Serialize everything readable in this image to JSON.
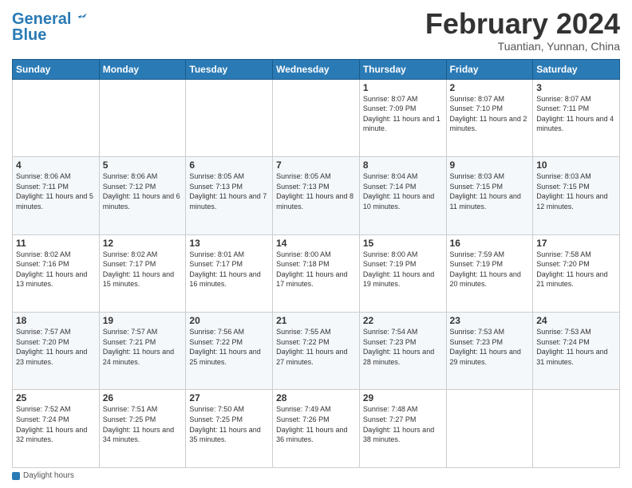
{
  "header": {
    "logo_line1": "General",
    "logo_line2": "Blue",
    "month_title": "February 2024",
    "location": "Tuantian, Yunnan, China"
  },
  "weekdays": [
    "Sunday",
    "Monday",
    "Tuesday",
    "Wednesday",
    "Thursday",
    "Friday",
    "Saturday"
  ],
  "weeks": [
    [
      {
        "day": "",
        "sunrise": "",
        "sunset": "",
        "daylight": ""
      },
      {
        "day": "",
        "sunrise": "",
        "sunset": "",
        "daylight": ""
      },
      {
        "day": "",
        "sunrise": "",
        "sunset": "",
        "daylight": ""
      },
      {
        "day": "",
        "sunrise": "",
        "sunset": "",
        "daylight": ""
      },
      {
        "day": "1",
        "sunrise": "Sunrise: 8:07 AM",
        "sunset": "Sunset: 7:09 PM",
        "daylight": "Daylight: 11 hours and 1 minute."
      },
      {
        "day": "2",
        "sunrise": "Sunrise: 8:07 AM",
        "sunset": "Sunset: 7:10 PM",
        "daylight": "Daylight: 11 hours and 2 minutes."
      },
      {
        "day": "3",
        "sunrise": "Sunrise: 8:07 AM",
        "sunset": "Sunset: 7:11 PM",
        "daylight": "Daylight: 11 hours and 4 minutes."
      }
    ],
    [
      {
        "day": "4",
        "sunrise": "Sunrise: 8:06 AM",
        "sunset": "Sunset: 7:11 PM",
        "daylight": "Daylight: 11 hours and 5 minutes."
      },
      {
        "day": "5",
        "sunrise": "Sunrise: 8:06 AM",
        "sunset": "Sunset: 7:12 PM",
        "daylight": "Daylight: 11 hours and 6 minutes."
      },
      {
        "day": "6",
        "sunrise": "Sunrise: 8:05 AM",
        "sunset": "Sunset: 7:13 PM",
        "daylight": "Daylight: 11 hours and 7 minutes."
      },
      {
        "day": "7",
        "sunrise": "Sunrise: 8:05 AM",
        "sunset": "Sunset: 7:13 PM",
        "daylight": "Daylight: 11 hours and 8 minutes."
      },
      {
        "day": "8",
        "sunrise": "Sunrise: 8:04 AM",
        "sunset": "Sunset: 7:14 PM",
        "daylight": "Daylight: 11 hours and 10 minutes."
      },
      {
        "day": "9",
        "sunrise": "Sunrise: 8:03 AM",
        "sunset": "Sunset: 7:15 PM",
        "daylight": "Daylight: 11 hours and 11 minutes."
      },
      {
        "day": "10",
        "sunrise": "Sunrise: 8:03 AM",
        "sunset": "Sunset: 7:15 PM",
        "daylight": "Daylight: 11 hours and 12 minutes."
      }
    ],
    [
      {
        "day": "11",
        "sunrise": "Sunrise: 8:02 AM",
        "sunset": "Sunset: 7:16 PM",
        "daylight": "Daylight: 11 hours and 13 minutes."
      },
      {
        "day": "12",
        "sunrise": "Sunrise: 8:02 AM",
        "sunset": "Sunset: 7:17 PM",
        "daylight": "Daylight: 11 hours and 15 minutes."
      },
      {
        "day": "13",
        "sunrise": "Sunrise: 8:01 AM",
        "sunset": "Sunset: 7:17 PM",
        "daylight": "Daylight: 11 hours and 16 minutes."
      },
      {
        "day": "14",
        "sunrise": "Sunrise: 8:00 AM",
        "sunset": "Sunset: 7:18 PM",
        "daylight": "Daylight: 11 hours and 17 minutes."
      },
      {
        "day": "15",
        "sunrise": "Sunrise: 8:00 AM",
        "sunset": "Sunset: 7:19 PM",
        "daylight": "Daylight: 11 hours and 19 minutes."
      },
      {
        "day": "16",
        "sunrise": "Sunrise: 7:59 AM",
        "sunset": "Sunset: 7:19 PM",
        "daylight": "Daylight: 11 hours and 20 minutes."
      },
      {
        "day": "17",
        "sunrise": "Sunrise: 7:58 AM",
        "sunset": "Sunset: 7:20 PM",
        "daylight": "Daylight: 11 hours and 21 minutes."
      }
    ],
    [
      {
        "day": "18",
        "sunrise": "Sunrise: 7:57 AM",
        "sunset": "Sunset: 7:20 PM",
        "daylight": "Daylight: 11 hours and 23 minutes."
      },
      {
        "day": "19",
        "sunrise": "Sunrise: 7:57 AM",
        "sunset": "Sunset: 7:21 PM",
        "daylight": "Daylight: 11 hours and 24 minutes."
      },
      {
        "day": "20",
        "sunrise": "Sunrise: 7:56 AM",
        "sunset": "Sunset: 7:22 PM",
        "daylight": "Daylight: 11 hours and 25 minutes."
      },
      {
        "day": "21",
        "sunrise": "Sunrise: 7:55 AM",
        "sunset": "Sunset: 7:22 PM",
        "daylight": "Daylight: 11 hours and 27 minutes."
      },
      {
        "day": "22",
        "sunrise": "Sunrise: 7:54 AM",
        "sunset": "Sunset: 7:23 PM",
        "daylight": "Daylight: 11 hours and 28 minutes."
      },
      {
        "day": "23",
        "sunrise": "Sunrise: 7:53 AM",
        "sunset": "Sunset: 7:23 PM",
        "daylight": "Daylight: 11 hours and 29 minutes."
      },
      {
        "day": "24",
        "sunrise": "Sunrise: 7:53 AM",
        "sunset": "Sunset: 7:24 PM",
        "daylight": "Daylight: 11 hours and 31 minutes."
      }
    ],
    [
      {
        "day": "25",
        "sunrise": "Sunrise: 7:52 AM",
        "sunset": "Sunset: 7:24 PM",
        "daylight": "Daylight: 11 hours and 32 minutes."
      },
      {
        "day": "26",
        "sunrise": "Sunrise: 7:51 AM",
        "sunset": "Sunset: 7:25 PM",
        "daylight": "Daylight: 11 hours and 34 minutes."
      },
      {
        "day": "27",
        "sunrise": "Sunrise: 7:50 AM",
        "sunset": "Sunset: 7:25 PM",
        "daylight": "Daylight: 11 hours and 35 minutes."
      },
      {
        "day": "28",
        "sunrise": "Sunrise: 7:49 AM",
        "sunset": "Sunset: 7:26 PM",
        "daylight": "Daylight: 11 hours and 36 minutes."
      },
      {
        "day": "29",
        "sunrise": "Sunrise: 7:48 AM",
        "sunset": "Sunset: 7:27 PM",
        "daylight": "Daylight: 11 hours and 38 minutes."
      },
      {
        "day": "",
        "sunrise": "",
        "sunset": "",
        "daylight": ""
      },
      {
        "day": "",
        "sunrise": "",
        "sunset": "",
        "daylight": ""
      }
    ]
  ],
  "footer": {
    "daylight_label": "Daylight hours"
  }
}
